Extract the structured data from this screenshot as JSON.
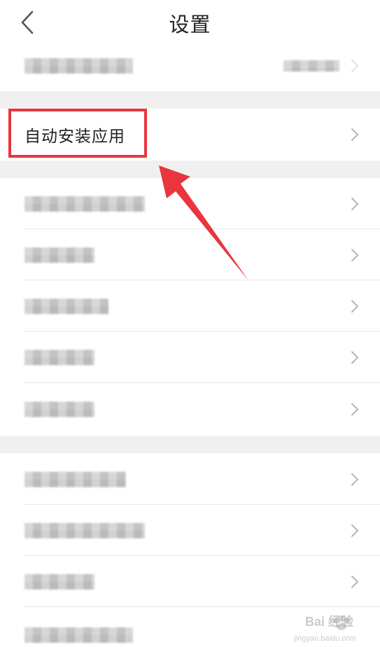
{
  "header": {
    "title": "设置"
  },
  "highlighted_item": {
    "label": "自动安装应用"
  },
  "watermark": {
    "brand": "Bai 经验",
    "url": "jingyan.baidu.com"
  },
  "colors": {
    "highlight": "#e8353e",
    "section_gap": "#f0f0f0",
    "divider": "#e8e8e8",
    "chevron": "#b5b5b5"
  },
  "icons": {
    "back": "chevron-left-icon",
    "row_action": "chevron-right-icon",
    "watermark": "paw-icon"
  }
}
